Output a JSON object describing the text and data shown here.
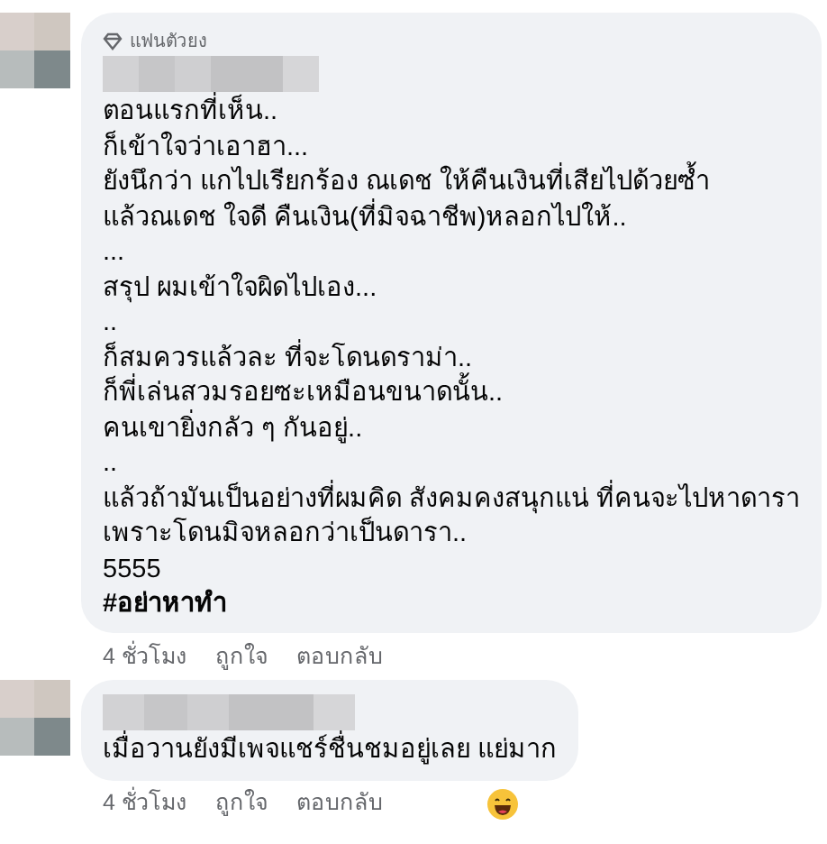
{
  "comments": [
    {
      "badge": "แฟนตัวยง",
      "lines": [
        "ตอนแรกที่เห็น..",
        "ก็เข้าใจว่าเอาฮา...",
        "ยังนึกว่า แกไปเรียกร้อง ณเดช ให้คืนเงินที่เสียไปด้วยซ้ำ",
        "แล้วณเดช ใจดี คืนเงิน(ที่มิจฉาชีพ)หลอกไปให้..",
        "...",
        "สรุป ผมเข้าใจผิดไปเอง...",
        "..",
        "ก็สมควรแล้วละ ที่จะโดนดราม่า..",
        "ก็พี่เล่นสวมรอยซะเหมือนขนาดนั้น..",
        "คนเขายิ่งกลัว ๆ กันอยู่..",
        "..",
        "แล้วถ้ามันเป็นอย่างที่ผมคิด สังคมคงสนุกแน่ ที่คนจะไปหาดารา",
        "เพราะโดนมิจหลอกว่าเป็นดารา..",
        "5555"
      ],
      "hashtag": "#อย่าหาทำ",
      "time": "4 ชั่วโมง",
      "like": "ถูกใจ",
      "reply": "ตอบกลับ"
    },
    {
      "lines": [
        "เมื่อวานยังมีเพจแชร์ชื่นชมอยู่เลย แย่มาก"
      ],
      "time": "4 ชั่วโมง",
      "like": "ถูกใจ",
      "reply": "ตอบกลับ",
      "reaction": true
    }
  ]
}
